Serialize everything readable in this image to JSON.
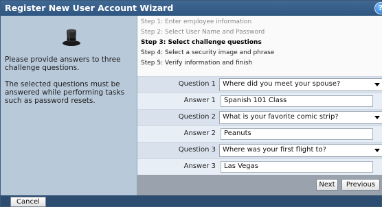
{
  "window": {
    "title": "Register New User Account Wizard",
    "help_icon": "question-icon"
  },
  "left_panel": {
    "icon": "top-hat-icon",
    "intro_text": "Please provide answers to three challenge questions.",
    "note_text": "The selected questions must be answered while performing tasks such as password resets."
  },
  "steps": [
    {
      "label": "Step 1: Enter employee information",
      "state": "done"
    },
    {
      "label": "Step 2: Select User Name and Password",
      "state": "done"
    },
    {
      "label": "Step 3: Select challenge questions",
      "state": "active"
    },
    {
      "label": "Step 4: Select a security image and phrase",
      "state": "pending"
    },
    {
      "label": "Step 5: Verify information and finish",
      "state": "pending"
    }
  ],
  "form": {
    "q1_label": "Question 1",
    "q1_value": "Where did you meet your spouse?",
    "a1_label": "Answer 1",
    "a1_value": "Spanish 101 Class",
    "q2_label": "Question 2",
    "q2_value": "What is your favorite comic strip?",
    "a2_label": "Answer 2",
    "a2_value": "Peanuts",
    "q3_label": "Question 3",
    "q3_value": "Where was your first flight to?",
    "a3_label": "Answer 3",
    "a3_value": "Las Vegas"
  },
  "buttons": {
    "next": "Next",
    "previous": "Previous",
    "cancel": "Cancel"
  },
  "colors": {
    "titlebar": "#2f5680",
    "left_panel": "#b8c9da",
    "nav_bar": "#9aa3ad",
    "bottom_bar": "#2c4d70"
  }
}
